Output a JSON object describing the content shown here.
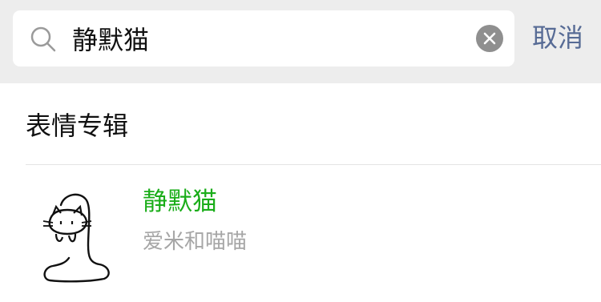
{
  "search": {
    "query": "静默猫",
    "cancel_label": "取消"
  },
  "section": {
    "title": "表情专辑"
  },
  "results": [
    {
      "title": "静默猫",
      "subtitle": "爱米和喵喵"
    }
  ],
  "colors": {
    "header_bg": "#ededed",
    "link": "#576b95",
    "highlight": "#1aad19",
    "muted": "#a6a6a6"
  },
  "icons": [
    "search-icon",
    "clear-icon",
    "sticker-cat-icon"
  ]
}
